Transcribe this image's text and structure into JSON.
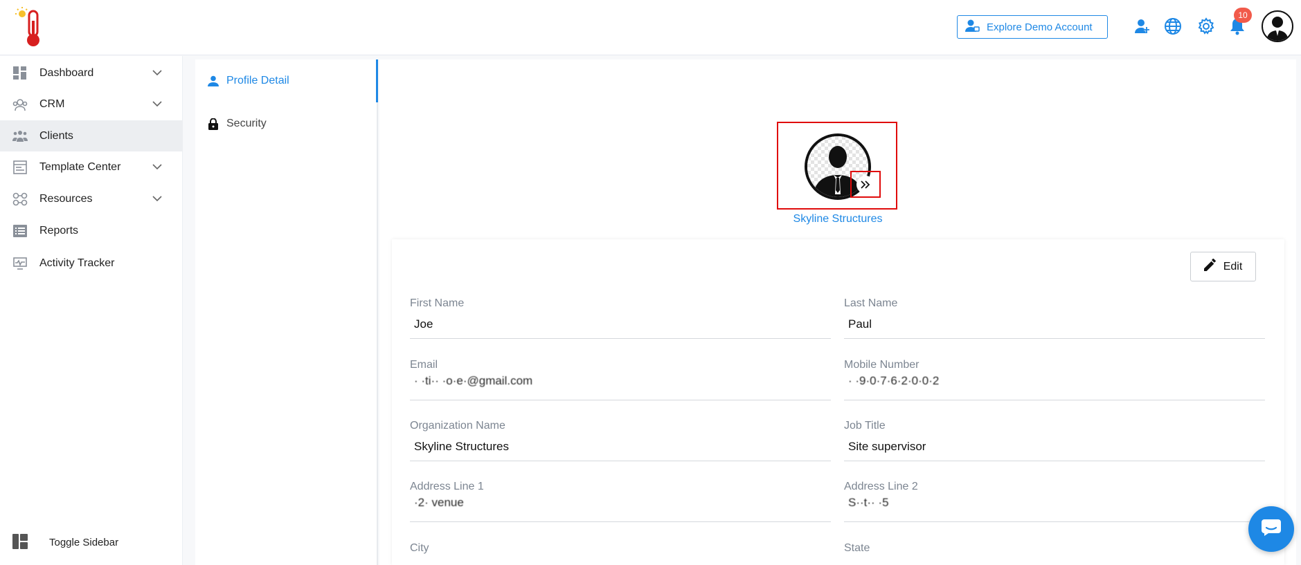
{
  "header": {
    "explore_label": "Explore Demo Account",
    "notification_count": "10"
  },
  "sidebar": {
    "items": [
      {
        "label": "Dashboard",
        "icon": "dashboard-icon",
        "has_chevron": true
      },
      {
        "label": "CRM",
        "icon": "crm-icon",
        "has_chevron": true
      },
      {
        "label": "Clients",
        "icon": "clients-icon",
        "has_chevron": false,
        "active": true
      },
      {
        "label": "Template Center",
        "icon": "template-icon",
        "has_chevron": true
      },
      {
        "label": "Resources",
        "icon": "resources-icon",
        "has_chevron": true
      },
      {
        "label": "Reports",
        "icon": "reports-icon",
        "has_chevron": false
      },
      {
        "label": "Activity Tracker",
        "icon": "activity-icon",
        "has_chevron": false
      }
    ],
    "toggle_label": "Toggle Sidebar"
  },
  "subnav": {
    "profile_detail": "Profile Detail",
    "security": "Security"
  },
  "profile": {
    "company_name": "Skyline Structures",
    "edit_label": "Edit",
    "fields": {
      "first_name": {
        "label": "First Name",
        "value": "Joe"
      },
      "last_name": {
        "label": "Last Name",
        "value": "Paul"
      },
      "email": {
        "label": "Email",
        "value": "·  ·ti··  ·o·e·@gmail.com"
      },
      "mobile": {
        "label": "Mobile Number",
        "value": "·  ·9·0·7·6·2·0·0·2"
      },
      "org_name": {
        "label": "Organization Name",
        "value": "Skyline Structures"
      },
      "job_title": {
        "label": "Job Title",
        "value": "Site supervisor"
      },
      "address1": {
        "label": "Address Line 1",
        "value": "·2·                          venue"
      },
      "address2": {
        "label": "Address Line 2",
        "value": "S··t··  ·5"
      },
      "city": {
        "label": "City",
        "value": ""
      },
      "state": {
        "label": "State",
        "value": ""
      }
    }
  },
  "colors": {
    "accent": "#1e88e5",
    "badge": "#f15a4a",
    "highlight": "#e00b0b"
  }
}
